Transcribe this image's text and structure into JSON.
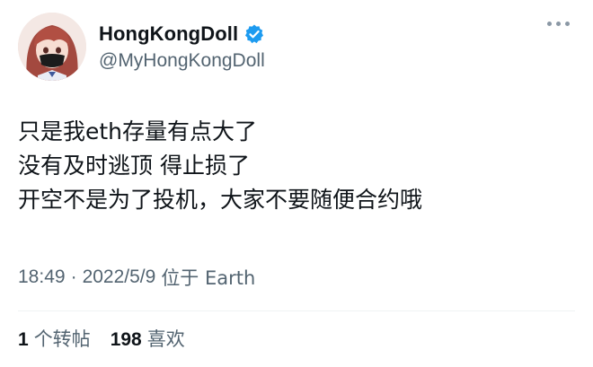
{
  "author": {
    "display_name": "HongKongDoll",
    "handle": "@MyHongKongDoll",
    "verified_icon": "verified-badge-icon",
    "verified_color": "#1d9bf0"
  },
  "tweet": {
    "lines": [
      "只是我eth存量有点大了",
      "没有及时逃顶 得止损了",
      "开空不是为了投机，大家不要随便合约哦"
    ],
    "time": "18:49",
    "separator": "·",
    "date": "2022/5/9",
    "location": "位于 Earth"
  },
  "stats": {
    "retweets_count": "1",
    "retweets_label": "个转帖",
    "likes_count": "198",
    "likes_label": "喜欢"
  },
  "colors": {
    "text": "#0f1419",
    "secondary": "#536471",
    "divider": "#eff3f4"
  }
}
